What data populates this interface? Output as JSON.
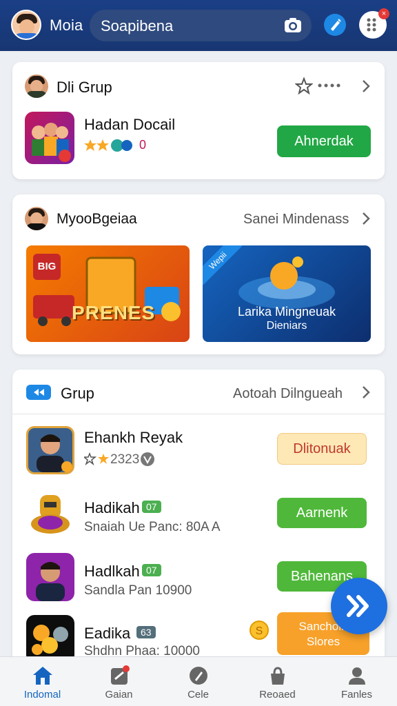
{
  "header": {
    "user_name": "Moia",
    "search_value": "Soapibena",
    "notification_count": "×"
  },
  "card_group1": {
    "title": "Dli Grup",
    "game_title": "Hadan Docail",
    "button_label": "Ahnerdak",
    "rating_text": "0"
  },
  "card_group2": {
    "title": "MyooBgeiaa",
    "link_text": "Sanei Mindenass",
    "banner1_text": "PRENES",
    "banner1_badge": "BIG",
    "banner2_line1": "Larika Mingneuak",
    "banner2_line2": "Dieniars",
    "banner2_ribbon": "Wepii"
  },
  "card_group3": {
    "title": "Grup",
    "link_text": "Aotoah Dilngueah",
    "rows": [
      {
        "title": "Ehankh Reyak",
        "sub": "2323",
        "button": "Dlitonuak"
      },
      {
        "title": "Hadikah",
        "tag": "07",
        "sub": "Snaiah Ue Panc: 80A A",
        "button": "Aarnenk"
      },
      {
        "title": "Hadlkah",
        "tag": "07",
        "sub": "Sandla Pan 10900",
        "button": "Bahenans"
      },
      {
        "title": "Eadika",
        "tag": "63",
        "sub": "Shdhn Phaa: 10000",
        "button_line1": "Sanchoin",
        "button_line2": "Slores"
      }
    ]
  },
  "bottom_nav": [
    {
      "label": "Indomal"
    },
    {
      "label": "Gaian"
    },
    {
      "label": "Cele"
    },
    {
      "label": "Reoaed"
    },
    {
      "label": "Fanles"
    }
  ],
  "colors": {
    "topbar": "#1b3f86",
    "accent_blue": "#1e6fe0",
    "green_button": "#21a745",
    "lime_button": "#4fb83a",
    "orange_button": "#f7a12a"
  }
}
